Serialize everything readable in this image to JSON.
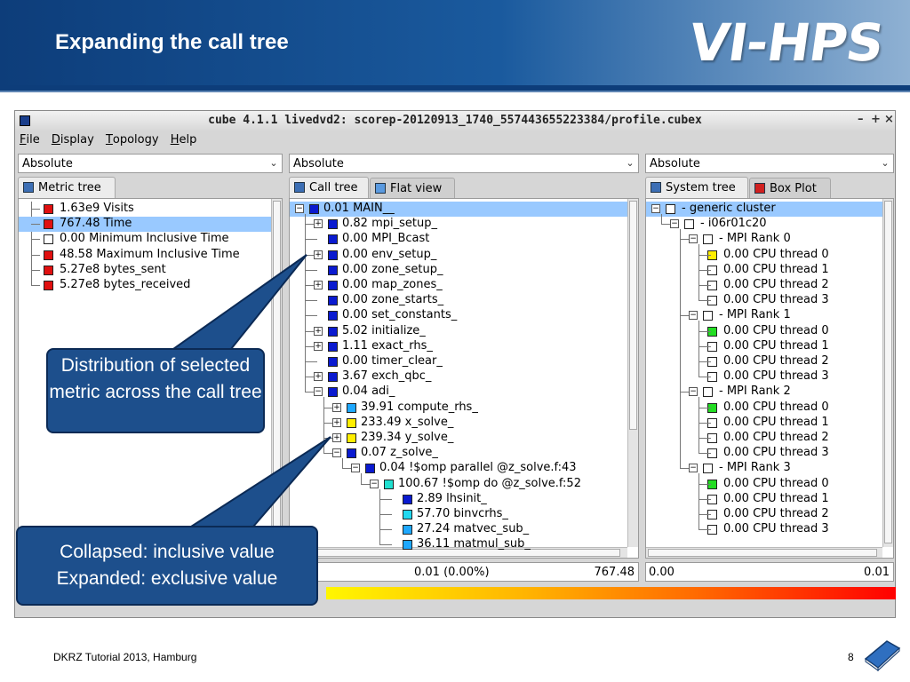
{
  "slide": {
    "title": "Expanding the call tree",
    "logo": "VI-HPS",
    "footer": "DKRZ Tutorial 2013, Hamburg",
    "page_number": "8"
  },
  "window": {
    "title": "cube 4.1.1 livedvd2: scorep-20120913_1740_557443655223384/profile.cubex",
    "buttons": [
      "–",
      "+",
      "×"
    ]
  },
  "menu": [
    {
      "label": "File",
      "u": "F",
      "rest": "ile"
    },
    {
      "label": "Display",
      "u": "D",
      "rest": "isplay"
    },
    {
      "label": "Topology",
      "u": "T",
      "rest": "opology"
    },
    {
      "label": "Help",
      "u": "H",
      "rest": "elp"
    }
  ],
  "combos": {
    "left": "Absolute",
    "middle": "Absolute",
    "right": "Absolute"
  },
  "tabs": {
    "left": [
      "Metric tree"
    ],
    "middle": [
      "Call tree",
      "Flat view"
    ],
    "right": [
      "System tree",
      "Box Plot"
    ]
  },
  "metric_tree": [
    {
      "value": "1.63e9",
      "name": "Visits",
      "color": "#e01010",
      "selected": false
    },
    {
      "value": "767.48",
      "name": "Time",
      "color": "#e01010",
      "selected": true
    },
    {
      "value": "0.00",
      "name": "Minimum Inclusive Time",
      "color": "#ffffff",
      "selected": false
    },
    {
      "value": "48.58",
      "name": "Maximum Inclusive Time",
      "color": "#e01010",
      "selected": false
    },
    {
      "value": "5.27e8",
      "name": "bytes_sent",
      "color": "#e01010",
      "selected": false
    },
    {
      "value": "5.27e8",
      "name": "bytes_received",
      "color": "#e01010",
      "selected": false
    }
  ],
  "call_tree": [
    {
      "value": "0.01",
      "name": "MAIN__",
      "color": "#0a1ad0",
      "depth": 0,
      "expander": "minus",
      "selected": true
    },
    {
      "value": "0.82",
      "name": "mpi_setup_",
      "color": "#0a1ad0",
      "depth": 1,
      "expander": "plus"
    },
    {
      "value": "0.00",
      "name": "MPI_Bcast",
      "color": "#0a1ad0",
      "depth": 1,
      "expander": "none"
    },
    {
      "value": "0.00",
      "name": "env_setup_",
      "color": "#0a1ad0",
      "depth": 1,
      "expander": "plus"
    },
    {
      "value": "0.00",
      "name": "zone_setup_",
      "color": "#0a1ad0",
      "depth": 1,
      "expander": "none"
    },
    {
      "value": "0.00",
      "name": "map_zones_",
      "color": "#0a1ad0",
      "depth": 1,
      "expander": "plus"
    },
    {
      "value": "0.00",
      "name": "zone_starts_",
      "color": "#0a1ad0",
      "depth": 1,
      "expander": "none"
    },
    {
      "value": "0.00",
      "name": "set_constants_",
      "color": "#0a1ad0",
      "depth": 1,
      "expander": "none"
    },
    {
      "value": "5.02",
      "name": "initialize_",
      "color": "#0a1ad0",
      "depth": 1,
      "expander": "plus"
    },
    {
      "value": "1.11",
      "name": "exact_rhs_",
      "color": "#0a1ad0",
      "depth": 1,
      "expander": "plus"
    },
    {
      "value": "0.00",
      "name": "timer_clear_",
      "color": "#0a1ad0",
      "depth": 1,
      "expander": "none"
    },
    {
      "value": "3.67",
      "name": "exch_qbc_",
      "color": "#0a1ad0",
      "depth": 1,
      "expander": "plus"
    },
    {
      "value": "0.04",
      "name": "adi_",
      "color": "#0a1ad0",
      "depth": 1,
      "expander": "minus"
    },
    {
      "value": "39.91",
      "name": "compute_rhs_",
      "color": "#1ea8ff",
      "depth": 2,
      "expander": "plus"
    },
    {
      "value": "233.49",
      "name": "x_solve_",
      "color": "#ffee00",
      "depth": 2,
      "expander": "plus"
    },
    {
      "value": "239.34",
      "name": "y_solve_",
      "color": "#ffee00",
      "depth": 2,
      "expander": "plus"
    },
    {
      "value": "0.07",
      "name": "z_solve_",
      "color": "#0a1ad0",
      "depth": 2,
      "expander": "minus"
    },
    {
      "value": "0.04",
      "name": "!$omp parallel @z_solve.f:43",
      "color": "#0a1ad0",
      "depth": 3,
      "expander": "minus"
    },
    {
      "value": "100.67",
      "name": "!$omp do @z_solve.f:52",
      "color": "#20e0d0",
      "depth": 4,
      "expander": "minus"
    },
    {
      "value": "2.89",
      "name": "lhsinit_",
      "color": "#0a1ad0",
      "depth": 5,
      "expander": "none"
    },
    {
      "value": "57.70",
      "name": "binvcrhs_",
      "color": "#20d8f0",
      "depth": 5,
      "expander": "none"
    },
    {
      "value": "27.24",
      "name": "matvec_sub_",
      "color": "#1ea8ff",
      "depth": 5,
      "expander": "none"
    },
    {
      "value": "36.11",
      "name": "matmul_sub_",
      "color": "#1ea8ff",
      "depth": 5,
      "expander": "none"
    }
  ],
  "system_tree": [
    {
      "label": "- generic cluster",
      "color": "#ffffff",
      "depth": 0,
      "expander": "minus",
      "selected": true
    },
    {
      "label": "- i06r01c20",
      "color": "#ffffff",
      "depth": 1,
      "expander": "minus"
    },
    {
      "label": "- MPI Rank 0",
      "color": "#ffffff",
      "depth": 2,
      "expander": "minus"
    },
    {
      "label": "0.00 CPU thread 0",
      "color": "#ffee00",
      "depth": 3,
      "expander": "none"
    },
    {
      "label": "0.00 CPU thread 1",
      "color": "#ffffff",
      "depth": 3,
      "expander": "none"
    },
    {
      "label": "0.00 CPU thread 2",
      "color": "#ffffff",
      "depth": 3,
      "expander": "none"
    },
    {
      "label": "0.00 CPU thread 3",
      "color": "#ffffff",
      "depth": 3,
      "expander": "none",
      "last": true
    },
    {
      "label": "- MPI Rank 1",
      "color": "#ffffff",
      "depth": 2,
      "expander": "minus"
    },
    {
      "label": "0.00 CPU thread 0",
      "color": "#22dd22",
      "depth": 3,
      "expander": "none"
    },
    {
      "label": "0.00 CPU thread 1",
      "color": "#ffffff",
      "depth": 3,
      "expander": "none"
    },
    {
      "label": "0.00 CPU thread 2",
      "color": "#ffffff",
      "depth": 3,
      "expander": "none"
    },
    {
      "label": "0.00 CPU thread 3",
      "color": "#ffffff",
      "depth": 3,
      "expander": "none",
      "last": true
    },
    {
      "label": "- MPI Rank 2",
      "color": "#ffffff",
      "depth": 2,
      "expander": "minus"
    },
    {
      "label": "0.00 CPU thread 0",
      "color": "#22dd22",
      "depth": 3,
      "expander": "none"
    },
    {
      "label": "0.00 CPU thread 1",
      "color": "#ffffff",
      "depth": 3,
      "expander": "none"
    },
    {
      "label": "0.00 CPU thread 2",
      "color": "#ffffff",
      "depth": 3,
      "expander": "none"
    },
    {
      "label": "0.00 CPU thread 3",
      "color": "#ffffff",
      "depth": 3,
      "expander": "none",
      "last": true
    },
    {
      "label": "- MPI Rank 3",
      "color": "#ffffff",
      "depth": 2,
      "expander": "minus"
    },
    {
      "label": "0.00 CPU thread 0",
      "color": "#22dd22",
      "depth": 3,
      "expander": "none"
    },
    {
      "label": "0.00 CPU thread 1",
      "color": "#ffffff",
      "depth": 3,
      "expander": "none"
    },
    {
      "label": "0.00 CPU thread 2",
      "color": "#ffffff",
      "depth": 3,
      "expander": "none"
    },
    {
      "label": "0.00 CPU thread 3",
      "color": "#ffffff",
      "depth": 3,
      "expander": "none",
      "last": true
    }
  ],
  "status": {
    "middle_value": "0.01 (0.00%)",
    "middle_max": "767.48",
    "right_min": "0.00",
    "right_max": "0.01"
  },
  "callouts": {
    "distribution": "Distribution of selected metric across the call tree",
    "collapsed_line1": "Collapsed: inclusive value",
    "collapsed_line2": "Expanded: exclusive value"
  }
}
